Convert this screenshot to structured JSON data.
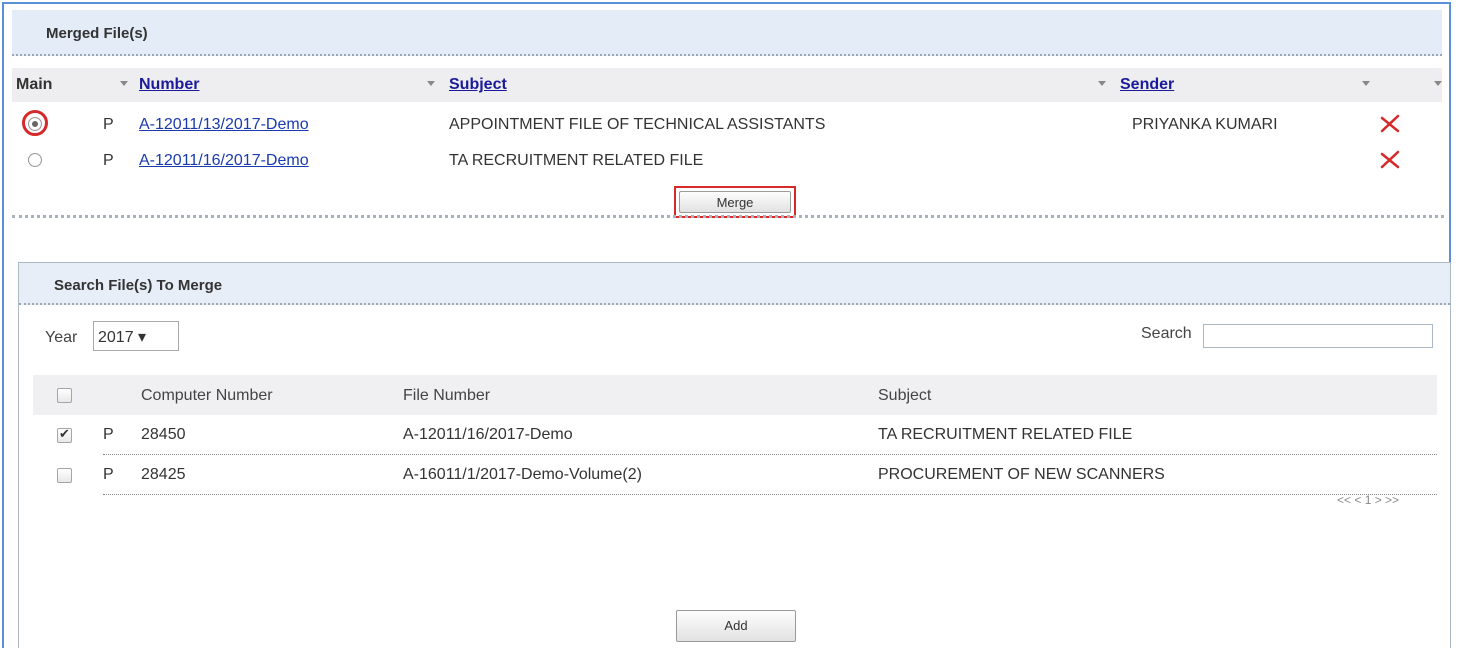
{
  "merged": {
    "title": "Merged File(s)",
    "columns": {
      "main": "Main",
      "number": "Number",
      "subject": "Subject",
      "sender": "Sender"
    },
    "rows": [
      {
        "selected": true,
        "type": "P",
        "number": "A-12011/13/2017-Demo",
        "subject": "APPOINTMENT FILE OF TECHNICAL ASSISTANTS",
        "sender": "PRIYANKA KUMARI"
      },
      {
        "selected": false,
        "type": "P",
        "number": "A-12011/16/2017-Demo",
        "subject": "TA RECRUITMENT RELATED FILE",
        "sender": ""
      }
    ],
    "merge_label": "Merge"
  },
  "search": {
    "title": "Search File(s) To Merge",
    "year_label": "Year",
    "year_value": "2017 ▾",
    "search_label": "Search",
    "search_value": "",
    "columns": {
      "computer_number": "Computer Number",
      "file_number": "File Number",
      "subject": "Subject"
    },
    "rows": [
      {
        "checked": true,
        "type": "P",
        "computer_number": "28450",
        "file_number": "A-12011/16/2017-Demo",
        "subject": "TA RECRUITMENT RELATED FILE"
      },
      {
        "checked": false,
        "type": "P",
        "computer_number": "28425",
        "file_number": "A-16011/1/2017-Demo-Volume(2)",
        "subject": "PROCUREMENT OF NEW SCANNERS"
      }
    ],
    "pager": "<< < 1 > >>",
    "add_label": "Add"
  },
  "colors": {
    "accent_border": "#5b8fd6",
    "highlight": "#d62a2a",
    "link": "#1a3ab0"
  }
}
